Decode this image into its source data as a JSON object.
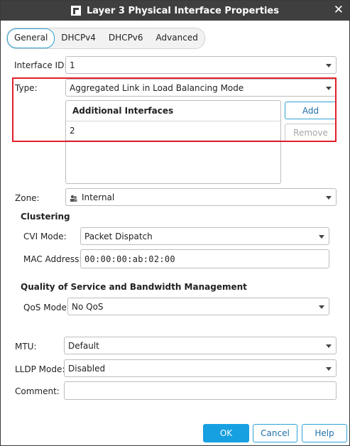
{
  "window": {
    "title": "Layer 3 Physical Interface Properties",
    "close_glyph": "✕"
  },
  "tabs": [
    {
      "label": "General",
      "active": true
    },
    {
      "label": "DHCPv4",
      "active": false
    },
    {
      "label": "DHCPv6",
      "active": false
    },
    {
      "label": "Advanced",
      "active": false
    }
  ],
  "interface_id": {
    "label": "Interface ID:",
    "value": "1"
  },
  "type": {
    "label": "Type:",
    "value": "Aggregated Link in Load Balancing Mode"
  },
  "additional_interfaces": {
    "header": "Additional Interfaces",
    "rows": [
      "2"
    ]
  },
  "buttons": {
    "add": "Add",
    "remove": "Remove",
    "ok": "OK",
    "cancel": "Cancel",
    "help": "Help"
  },
  "zone": {
    "label": "Zone:",
    "value": "Internal",
    "icon": "zone-icon"
  },
  "clustering": {
    "title": "Clustering",
    "cvi_mode_label": "CVI Mode:",
    "cvi_mode_value": "Packet Dispatch",
    "mac_label": "MAC Address:",
    "mac_value": "00:00:00:ab:02:00"
  },
  "qos": {
    "title": "Quality of Service and Bandwidth Management",
    "mode_label": "QoS Mode:",
    "mode_value": "No QoS"
  },
  "mtu": {
    "label": "MTU:",
    "value": "Default"
  },
  "lldp": {
    "label": "LLDP Mode:",
    "value": "Disabled"
  },
  "comment": {
    "label": "Comment:",
    "value": ""
  },
  "colors": {
    "accent": "#17a0e1",
    "highlight": "#e0202a",
    "titlebar": "#3f3f3f"
  }
}
